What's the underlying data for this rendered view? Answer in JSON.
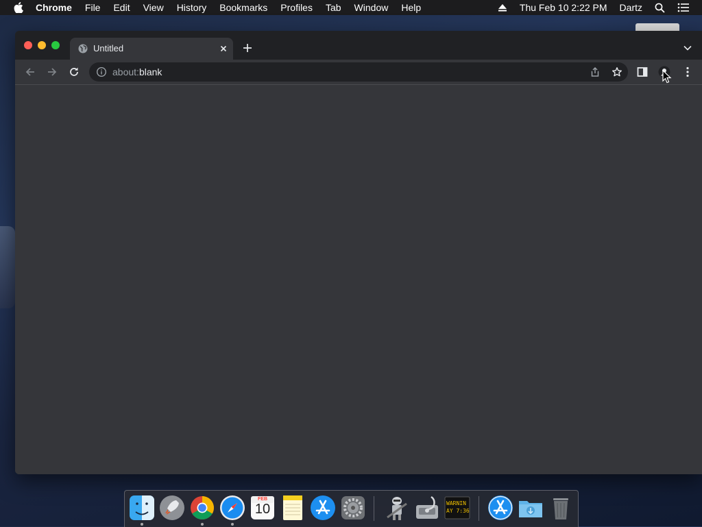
{
  "menubar": {
    "app_name": "Chrome",
    "items": [
      "File",
      "Edit",
      "View",
      "History",
      "Bookmarks",
      "Profiles",
      "Tab",
      "Window",
      "Help"
    ],
    "datetime": "Thu Feb 10  2:22 PM",
    "user": "Dartz"
  },
  "browser": {
    "tab": {
      "title": "Untitled"
    },
    "omnibox": {
      "scheme": "about:",
      "host": "blank"
    }
  },
  "dock": {
    "items": [
      {
        "name": "Finder",
        "running": true
      },
      {
        "name": "Launchpad",
        "running": false
      },
      {
        "name": "Google Chrome",
        "running": true
      },
      {
        "name": "Safari",
        "running": true
      },
      {
        "name": "Calendar",
        "running": false,
        "month": "FEB",
        "day": "10"
      },
      {
        "name": "Notes",
        "running": false
      },
      {
        "name": "App Store",
        "running": false
      },
      {
        "name": "System Preferences",
        "running": false
      },
      {
        "name": "Automator",
        "running": false
      },
      {
        "name": "Disk Utility",
        "running": false
      },
      {
        "name": "Console",
        "running": false,
        "line1": "WARNIN",
        "line2": "AY 7:36"
      },
      {
        "name": "Applications",
        "running": false
      },
      {
        "name": "Downloads",
        "running": false
      },
      {
        "name": "Trash",
        "running": false
      }
    ]
  },
  "colors": {
    "menubar_bg": "#1c1c1e",
    "tabstrip_bg": "#202124",
    "toolbar_bg": "#35363a",
    "close": "#ff5f57",
    "minimize": "#febc2e",
    "zoom": "#28c840"
  }
}
